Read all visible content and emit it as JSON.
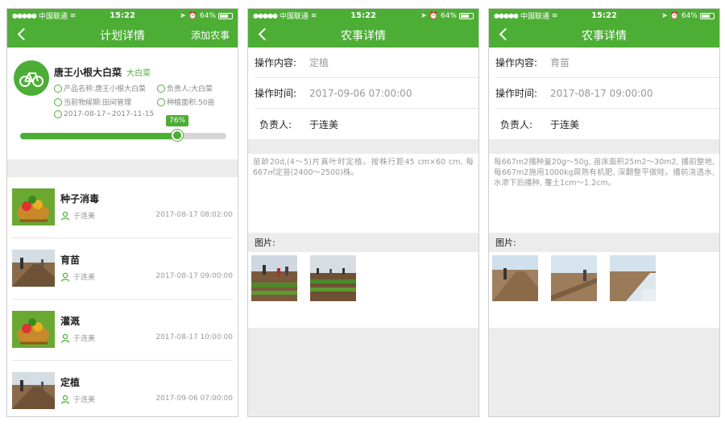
{
  "status": {
    "carrier": "中国联通",
    "time": "15:22",
    "battery": "64%"
  },
  "plan": {
    "title": "计划详情",
    "action": "添加农事",
    "name": "唐王小根大白菜",
    "tag": "大白菜",
    "product": "产品名称:唐王小根大白菜",
    "owner": "负责人:大白菜",
    "phase": "当前物候期:田间管理",
    "area": "种植面积:50亩",
    "dates": "2017-08-17~2017-11-15",
    "progress": 76,
    "progress_label": "76%",
    "tasks": [
      {
        "title": "种子消毒",
        "person": "于连美",
        "time": "2017-08-17 08:02:00",
        "thumb": "veg"
      },
      {
        "title": "育苗",
        "person": "于连美",
        "time": "2017-08-17 09:00:00",
        "thumb": "field"
      },
      {
        "title": "灌溉",
        "person": "于连美",
        "time": "2017-08-17 10:00:00",
        "thumb": "veg"
      },
      {
        "title": "定植",
        "person": "于连美",
        "time": "2017-09-06 07:00:00",
        "thumb": "field"
      }
    ]
  },
  "detail1": {
    "title": "农事详情",
    "content_label": "操作内容:",
    "content_value": "定植",
    "time_label": "操作时间:",
    "time_value": "2017-09-06 07:00:00",
    "person_label": "负责人:",
    "person_value": "于连美",
    "description": "苗龄20d,(4～5)片真叶时定植。按株行距45 cm×60 cm, 每667㎡定苗(2400～2500)株。",
    "pictures_label": "图片:"
  },
  "detail2": {
    "title": "农事详情",
    "content_label": "操作内容:",
    "content_value": "育苗",
    "time_label": "操作时间:",
    "time_value": "2017-08-17 09:00:00",
    "person_label": "负责人:",
    "person_value": "于连美",
    "description": "每667m2播种量20g～50g, 苗床面积25m2～30m2, 播前整地, 每667m2施用1000kg腐熟有机肥, 深翻整平做畦。播前浇透水, 水渗下后播种, 覆土1cm～1.2cm。",
    "pictures_label": "图片:"
  },
  "colors": {
    "brand": "#4cae35"
  }
}
